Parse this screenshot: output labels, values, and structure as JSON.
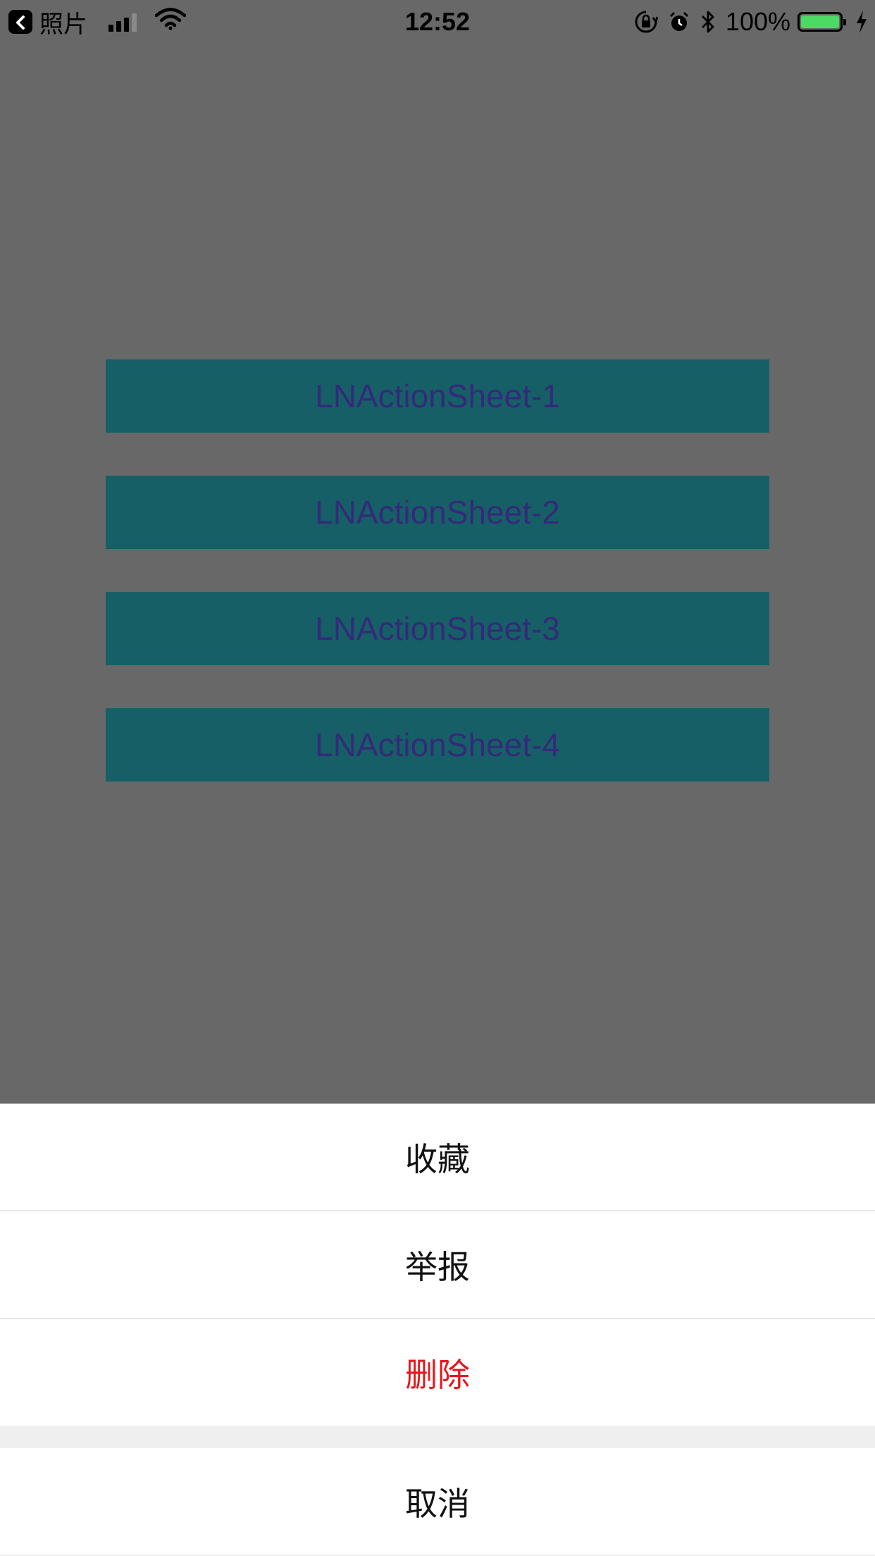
{
  "status_bar": {
    "back_app": "照片",
    "time": "12:52",
    "battery": "100%",
    "battery_color": "#4cd964"
  },
  "main": {
    "buttons": [
      {
        "label": "LNActionSheet-1"
      },
      {
        "label": "LNActionSheet-2"
      },
      {
        "label": "LNActionSheet-3"
      },
      {
        "label": "LNActionSheet-4"
      }
    ],
    "button_bg": "#165f66",
    "button_text_color": "#342a7a"
  },
  "action_sheet": {
    "items": [
      {
        "label": "收藏"
      },
      {
        "label": "举报"
      },
      {
        "label": "删除",
        "style": "destructive",
        "color": "#e8151b"
      }
    ],
    "cancel": {
      "label": "取消"
    }
  },
  "icons": [
    "back-chevron-icon",
    "signal-icon",
    "wifi-icon",
    "rotation-lock-icon",
    "alarm-icon",
    "bluetooth-icon",
    "battery-icon",
    "charging-icon"
  ]
}
